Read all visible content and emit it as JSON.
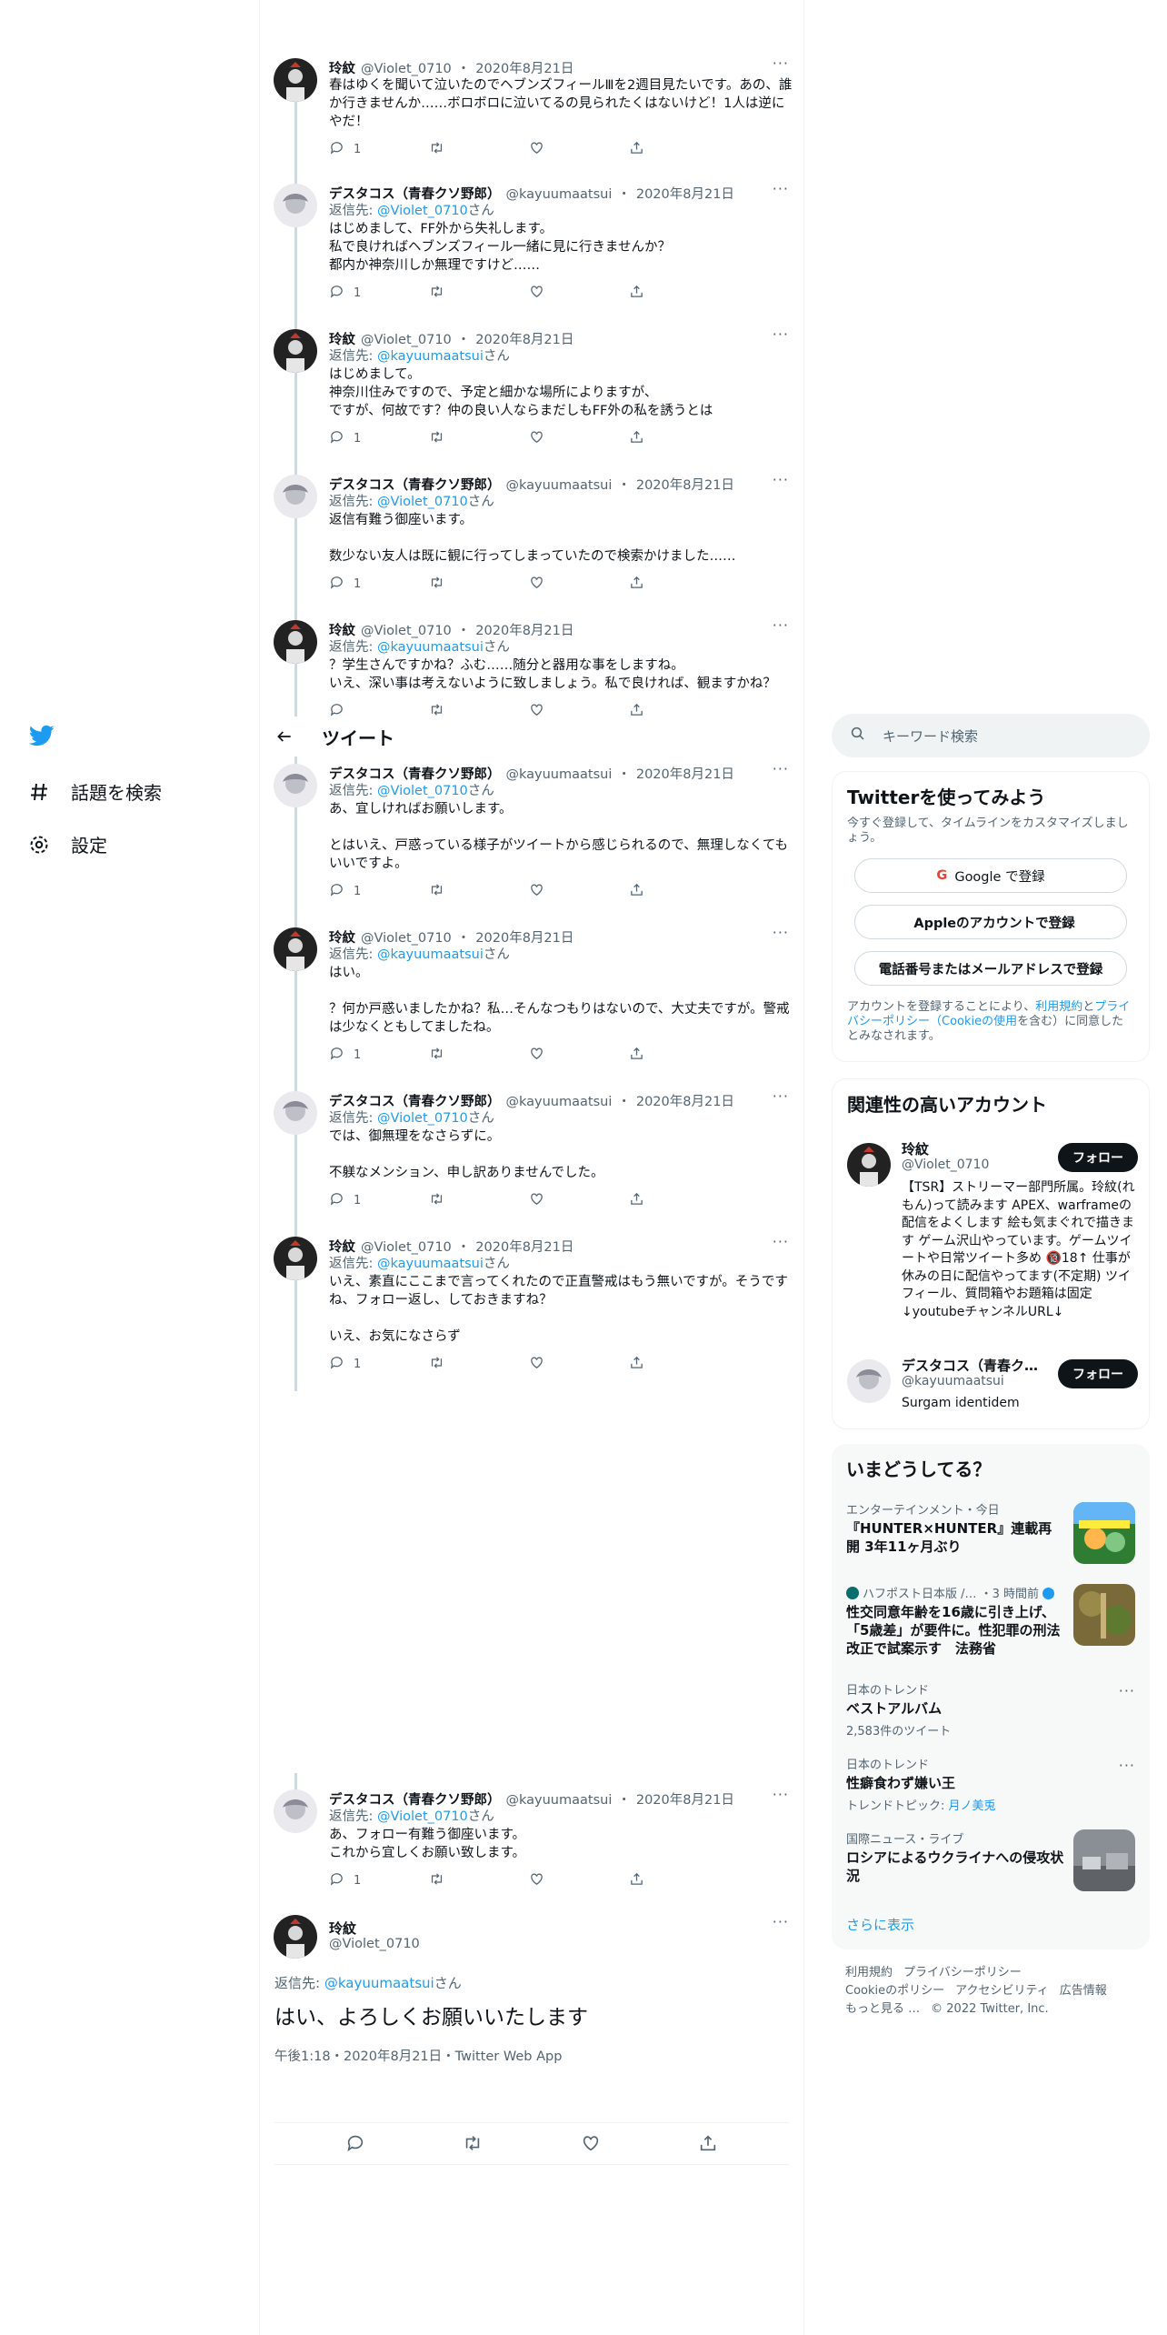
{
  "sidebar": {
    "items": [
      {
        "label": "話題を検索",
        "icon": "hash-icon"
      },
      {
        "label": "設定",
        "icon": "gear-icon"
      }
    ]
  },
  "header": {
    "title": "ツイート"
  },
  "tweets": [
    {
      "name": "玲紋",
      "handle": "@Violet_0710",
      "date": "2020年8月21日",
      "reply_to": "",
      "text": "春はゆくを聞いて泣いたのでヘブンズフィールⅢを2週目見たいです。あの、誰か行きませんか……ボロボロに泣いてるの見られたくはないけど！1人は逆にやだ！",
      "replies": "1"
    },
    {
      "name": "デスタコス（青春クソ野郎）",
      "handle": "@kayuumaatsui",
      "date": "2020年8月21日",
      "reply_to": "@Violet_0710",
      "text": "はじめまして、FF外から失礼します。\n私で良ければヘブンズフィール一緒に見に行きませんか？\n都内か神奈川しか無理ですけど……",
      "replies": "1"
    },
    {
      "name": "玲紋",
      "handle": "@Violet_0710",
      "date": "2020年8月21日",
      "reply_to": "@kayuumaatsui",
      "text": "はじめまして。\n神奈川住みですので、予定と細かな場所によりますが、\nですが、何故です？仲の良い人ならまだしもFF外の私を誘うとは",
      "replies": "1"
    },
    {
      "name": "デスタコス（青春クソ野郎）",
      "handle": "@kayuumaatsui",
      "date": "2020年8月21日",
      "reply_to": "@Violet_0710",
      "text": "返信有難う御座います。\n\n数少ない友人は既に観に行ってしまっていたので検索かけました……",
      "replies": "1"
    },
    {
      "name": "玲紋",
      "handle": "@Violet_0710",
      "date": "2020年8月21日",
      "reply_to": "@kayuumaatsui",
      "text": "？学生さんですかね？ふむ……随分と器用な事をしますね。\nいえ、深い事は考えないように致しましょう。私で良ければ、観ますかね？",
      "replies": ""
    },
    {
      "name": "デスタコス（青春クソ野郎）",
      "handle": "@kayuumaatsui",
      "date": "2020年8月21日",
      "reply_to": "@Violet_0710",
      "text": "あ、宜しければお願いします。\n\nとはいえ、戸惑っている様子がツイートから感じられるので、無理しなくてもいいですよ。",
      "replies": "1"
    },
    {
      "name": "玲紋",
      "handle": "@Violet_0710",
      "date": "2020年8月21日",
      "reply_to": "@kayuumaatsui",
      "text": "はい。\n\n？何か戸惑いましたかね？私…そんなつもりはないので、大丈夫ですが。警戒は少なくともしてましたね。",
      "replies": "1"
    },
    {
      "name": "デスタコス（青春クソ野郎）",
      "handle": "@kayuumaatsui",
      "date": "2020年8月21日",
      "reply_to": "@Violet_0710",
      "text": "では、御無理をなさらずに。\n\n不躾なメンション、申し訳ありませんでした。",
      "replies": "1"
    },
    {
      "name": "玲紋",
      "handle": "@Violet_0710",
      "date": "2020年8月21日",
      "reply_to": "@kayuumaatsui",
      "text": "いえ、素直にここまで言ってくれたので正直警戒はもう無いですが。そうですね、フォロー返し、しておきますね？\n\nいえ、お気になさらず",
      "replies": "1"
    },
    {
      "name": "デスタコス（青春クソ野郎）",
      "handle": "@kayuumaatsui",
      "date": "2020年8月21日",
      "reply_to": "@Violet_0710",
      "text": "あ、フォロー有難う御座います。\nこれから宜しくお願い致します。",
      "replies": "1"
    }
  ],
  "main_tweet": {
    "name": "玲紋",
    "handle": "@Violet_0710",
    "reply_prefix": "返信先: ",
    "reply_to": "@kayuumaatsui",
    "reply_suffix": "さん",
    "text": "はい、よろしくお願いいたします",
    "meta": "午後1:18・2020年8月21日・Twitter Web App"
  },
  "labels": {
    "reply_prefix": "返信先: ",
    "reply_suffix": "さん",
    "dot": "・"
  },
  "search": {
    "placeholder": "キーワード検索"
  },
  "signup": {
    "title": "Twitterを使ってみよう",
    "subtitle": "今すぐ登録して、タイムラインをカスタマイズしましょう。",
    "google": "Google で登録",
    "apple": "Appleのアカウントで登録",
    "phone": "電話番号またはメールアドレスで登録",
    "terms_a": "アカウントを登録することにより、",
    "terms_link1": "利用規約",
    "terms_b": "と",
    "terms_link2": "プライバシーポリシー（Cookieの使用",
    "terms_c": "を含む）に同意したとみなされます。"
  },
  "related": {
    "title": "関連性の高いアカウント",
    "accounts": [
      {
        "name": "玲紋",
        "handle": "@Violet_0710",
        "button": "フォロー",
        "bio": "【TSR】ストリーマー部門所属。玲紋(れもん)って読みます APEX、warframeの配信をよくします 絵も気まぐれで描きます ゲーム沢山やっています。ゲームツイートや日常ツイート多め 🔞18↑ 仕事が休みの日に配信やってます(不定期) ツイフィール、質問箱やお題箱は固定↓youtubeチャンネルURL↓"
      },
      {
        "name": "デスタコス（青春ク…",
        "handle": "@kayuumaatsui",
        "button": "フォロー",
        "bio": "Surgam identidem"
      }
    ]
  },
  "trends": {
    "title": "いまどうしてる？",
    "items": [
      {
        "cat": "エンターテインメント・今日",
        "title": "『HUNTER×HUNTER』連載再開 3年11ヶ月ぶり",
        "sub": ""
      },
      {
        "cat": "ハフポスト日本版 /… ・3 時間前",
        "title": "性交同意年齢を16歳に引き上げ、「5歳差」が要件に。性犯罪の刑法改正で試案示す　法務省",
        "sub": ""
      },
      {
        "cat": "日本のトレンド",
        "title": "ベストアルバム",
        "sub": "2,583件のツイート"
      },
      {
        "cat": "日本のトレンド",
        "title": "性癖食わず嫌い王",
        "sub_prefix": "トレンドトピック: ",
        "sub_link": "月ノ美兎"
      },
      {
        "cat": "国際ニュース・ライブ",
        "title": "ロシアによるウクライナへの侵攻状況",
        "sub": ""
      }
    ],
    "show_more": "さらに表示"
  },
  "footer": {
    "links": [
      "利用規約",
      "プライバシーポリシー",
      "Cookieのポリシー",
      "アクセシビリティ",
      "広告情報",
      "もっと見る …"
    ],
    "copyright": "© 2022 Twitter, Inc."
  },
  "colors": {
    "accent": "#1d9bf0",
    "text": "#0f1419",
    "muted": "#536471",
    "border": "#eff3f4"
  }
}
